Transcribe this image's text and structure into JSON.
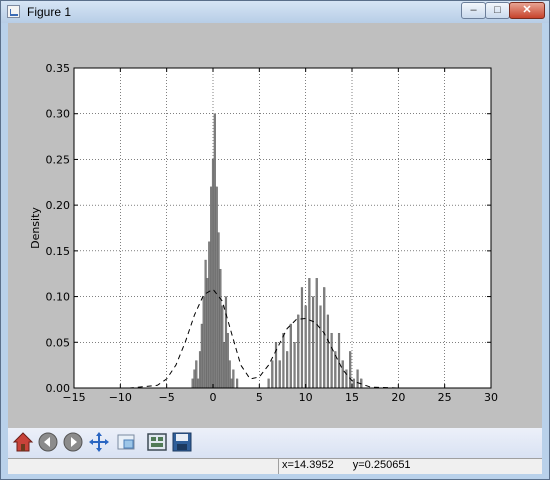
{
  "window": {
    "title": "Figure 1",
    "minimize_glyph": "–",
    "maximize_glyph": "□",
    "close_glyph": "✕"
  },
  "toolbar": {
    "items": [
      {
        "name": "home-icon",
        "label": "Home"
      },
      {
        "name": "back-icon",
        "label": "Back"
      },
      {
        "name": "forward-icon",
        "label": "Forward"
      },
      {
        "name": "pan-icon",
        "label": "Pan"
      },
      {
        "name": "zoom-icon",
        "label": "Zoom"
      },
      {
        "name": "subplots-icon",
        "label": "Subplots"
      },
      {
        "name": "save-icon",
        "label": "Save"
      }
    ]
  },
  "status": {
    "x_readout": "x=14.3952",
    "y_readout": "y=0.250651"
  },
  "chart_data": {
    "type": "bar",
    "title": "",
    "xlabel": "",
    "ylabel": "Density",
    "xlim": [
      -15,
      30
    ],
    "ylim": [
      0,
      0.35
    ],
    "xticks": [
      -15,
      -10,
      -5,
      0,
      5,
      10,
      15,
      20,
      25,
      30
    ],
    "yticks": [
      0.0,
      0.05,
      0.1,
      0.15,
      0.2,
      0.25,
      0.3,
      0.35
    ],
    "ytick_labels": [
      "0.00",
      "0.05",
      "0.10",
      "0.15",
      "0.20",
      "0.25",
      "0.30",
      "0.35"
    ],
    "grid": true,
    "bar_color": "#808080",
    "histogram": [
      {
        "x": -2.2,
        "y": 0.01
      },
      {
        "x": -2.0,
        "y": 0.02
      },
      {
        "x": -1.8,
        "y": 0.03
      },
      {
        "x": -1.6,
        "y": 0.01
      },
      {
        "x": -1.4,
        "y": 0.04
      },
      {
        "x": -1.2,
        "y": 0.07
      },
      {
        "x": -1.0,
        "y": 0.1
      },
      {
        "x": -0.8,
        "y": 0.14
      },
      {
        "x": -0.6,
        "y": 0.12
      },
      {
        "x": -0.4,
        "y": 0.16
      },
      {
        "x": -0.2,
        "y": 0.22
      },
      {
        "x": 0.0,
        "y": 0.25
      },
      {
        "x": 0.2,
        "y": 0.3
      },
      {
        "x": 0.4,
        "y": 0.22
      },
      {
        "x": 0.6,
        "y": 0.17
      },
      {
        "x": 0.8,
        "y": 0.13
      },
      {
        "x": 1.0,
        "y": 0.09
      },
      {
        "x": 1.2,
        "y": 0.05
      },
      {
        "x": 1.4,
        "y": 0.1
      },
      {
        "x": 1.6,
        "y": 0.06
      },
      {
        "x": 1.8,
        "y": 0.03
      },
      {
        "x": 2.0,
        "y": 0.01
      },
      {
        "x": 2.2,
        "y": 0.02
      },
      {
        "x": 2.6,
        "y": 0.01
      },
      {
        "x": 6.0,
        "y": 0.01
      },
      {
        "x": 6.4,
        "y": 0.03
      },
      {
        "x": 6.8,
        "y": 0.05
      },
      {
        "x": 7.2,
        "y": 0.03
      },
      {
        "x": 7.6,
        "y": 0.06
      },
      {
        "x": 8.0,
        "y": 0.04
      },
      {
        "x": 8.4,
        "y": 0.07
      },
      {
        "x": 8.8,
        "y": 0.05
      },
      {
        "x": 9.2,
        "y": 0.08
      },
      {
        "x": 9.6,
        "y": 0.11
      },
      {
        "x": 10.0,
        "y": 0.09
      },
      {
        "x": 10.4,
        "y": 0.12
      },
      {
        "x": 10.8,
        "y": 0.1
      },
      {
        "x": 11.2,
        "y": 0.12
      },
      {
        "x": 11.6,
        "y": 0.09
      },
      {
        "x": 12.0,
        "y": 0.11
      },
      {
        "x": 12.4,
        "y": 0.08
      },
      {
        "x": 12.8,
        "y": 0.06
      },
      {
        "x": 13.2,
        "y": 0.04
      },
      {
        "x": 13.6,
        "y": 0.06
      },
      {
        "x": 14.0,
        "y": 0.03
      },
      {
        "x": 14.4,
        "y": 0.02
      },
      {
        "x": 14.8,
        "y": 0.04
      },
      {
        "x": 15.2,
        "y": 0.01
      },
      {
        "x": 15.6,
        "y": 0.02
      },
      {
        "x": 16.0,
        "y": 0.01
      }
    ],
    "bar_width": 0.2,
    "density_curve": {
      "style": "dashed",
      "color": "#000000",
      "points": [
        [
          -12,
          0.0
        ],
        [
          -9,
          0.0
        ],
        [
          -6,
          0.003
        ],
        [
          -5,
          0.01
        ],
        [
          -4,
          0.025
        ],
        [
          -3,
          0.05
        ],
        [
          -2,
          0.08
        ],
        [
          -1,
          0.102
        ],
        [
          0,
          0.108
        ],
        [
          1,
          0.095
        ],
        [
          2,
          0.06
        ],
        [
          3,
          0.025
        ],
        [
          4,
          0.01
        ],
        [
          5,
          0.012
        ],
        [
          6,
          0.025
        ],
        [
          7,
          0.045
        ],
        [
          8,
          0.065
        ],
        [
          9,
          0.075
        ],
        [
          10,
          0.076
        ],
        [
          11,
          0.072
        ],
        [
          12,
          0.06
        ],
        [
          13,
          0.04
        ],
        [
          14,
          0.02
        ],
        [
          15,
          0.008
        ],
        [
          17,
          0.001
        ],
        [
          20,
          0.0
        ],
        [
          26,
          0.0
        ]
      ]
    }
  }
}
